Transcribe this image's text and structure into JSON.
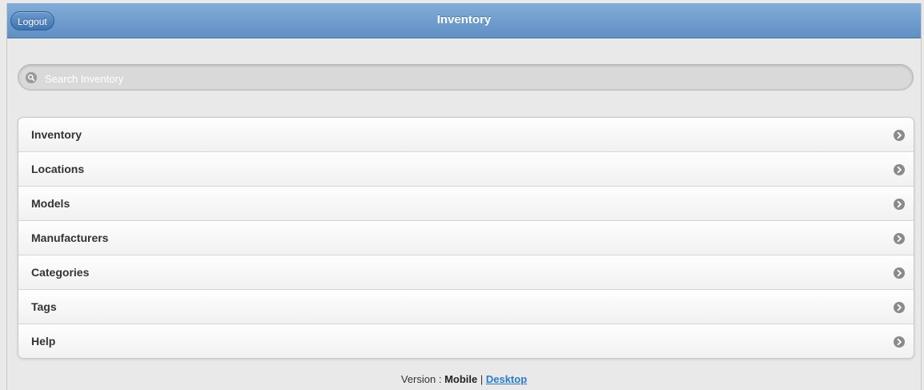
{
  "header": {
    "title": "Inventory",
    "logout_label": "Logout",
    "bar_color": "#6c9ad0"
  },
  "search": {
    "placeholder": "Search Inventory",
    "value": ""
  },
  "menu": {
    "items": [
      {
        "label": "Inventory",
        "icon": "chevron-right-circle-icon"
      },
      {
        "label": "Locations",
        "icon": "chevron-right-circle-icon"
      },
      {
        "label": "Models",
        "icon": "chevron-right-circle-icon"
      },
      {
        "label": "Manufacturers",
        "icon": "chevron-right-circle-icon"
      },
      {
        "label": "Categories",
        "icon": "chevron-right-circle-icon"
      },
      {
        "label": "Tags",
        "icon": "chevron-right-circle-icon"
      },
      {
        "label": "Help",
        "icon": "chevron-right-circle-icon"
      }
    ]
  },
  "footer": {
    "version_prefix": "Version : ",
    "mobile_label": "Mobile",
    "separator": " | ",
    "desktop_label": "Desktop",
    "link_color": "#2a7bd0"
  }
}
